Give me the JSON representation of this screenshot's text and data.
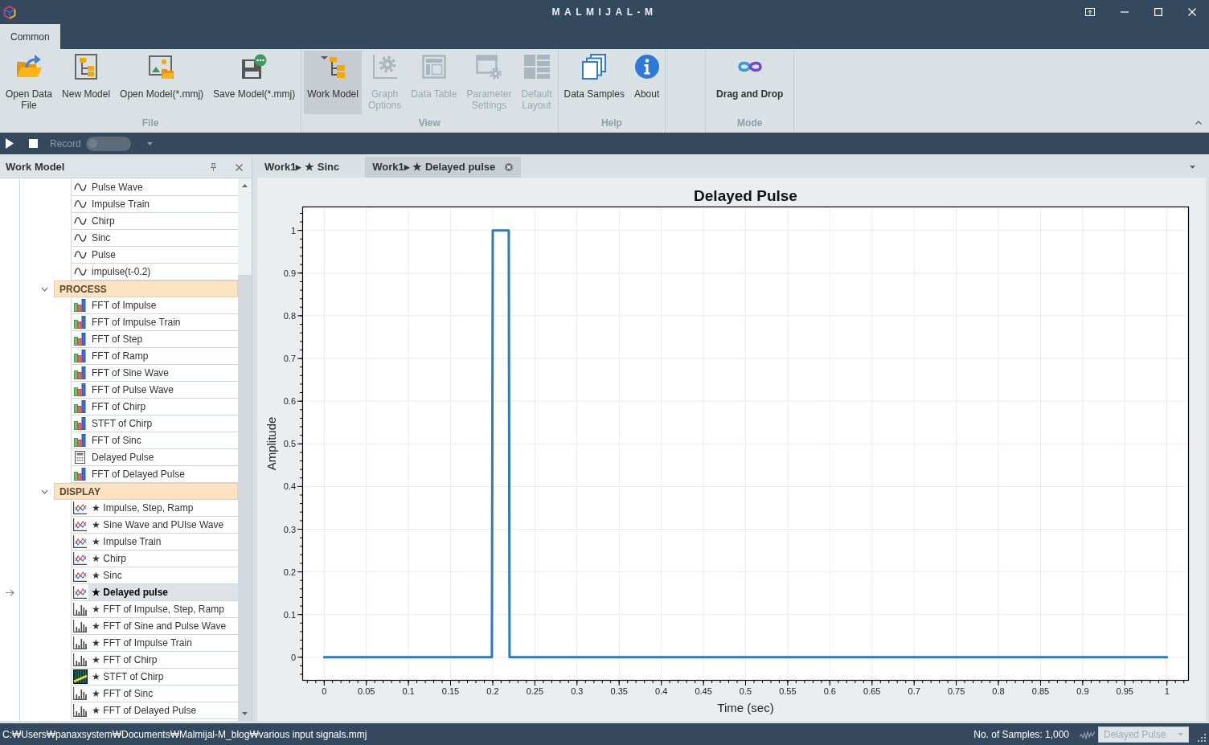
{
  "window": {
    "title": "MALMIJAL-M"
  },
  "ribbon": {
    "tabs": [
      {
        "label": "Common",
        "selected": true
      }
    ],
    "groups": [
      {
        "label": "File",
        "buttons": [
          {
            "kind": "open-data",
            "label": "Open Data\nFile",
            "selected": false,
            "disabled": false
          },
          {
            "kind": "new-model",
            "label": "New Model",
            "selected": false,
            "disabled": false
          },
          {
            "kind": "open-model",
            "label": "Open Model(*.mmj)",
            "selected": false,
            "disabled": false
          },
          {
            "kind": "save-model",
            "label": "Save Model(*.mmj)",
            "selected": false,
            "disabled": false
          }
        ]
      },
      {
        "label": "View",
        "buttons": [
          {
            "kind": "work-model",
            "label": "Work Model",
            "selected": true,
            "disabled": false
          },
          {
            "kind": "graph-options",
            "label": "Graph\nOptions",
            "selected": false,
            "disabled": true
          },
          {
            "kind": "data-table",
            "label": "Data Table",
            "selected": false,
            "disabled": true
          },
          {
            "kind": "parameter-settings",
            "label": "Parameter\nSettings",
            "selected": false,
            "disabled": true
          },
          {
            "kind": "default-layout",
            "label": "Default\nLayout",
            "selected": false,
            "disabled": true
          }
        ]
      },
      {
        "label": "Help",
        "buttons": [
          {
            "kind": "data-samples",
            "label": "Data Samples",
            "selected": false,
            "disabled": false
          },
          {
            "kind": "about",
            "label": "About",
            "selected": false,
            "disabled": false
          }
        ]
      },
      {
        "label": "Mode",
        "buttons": [
          {
            "kind": "drag-drop",
            "label": "Drag and Drop",
            "selected": false,
            "disabled": false,
            "on": true
          }
        ]
      }
    ]
  },
  "toolbar": {
    "record_label": "Record",
    "recording": false
  },
  "work_model_panel": {
    "title": "Work Model",
    "tree": [
      {
        "children": [
          {
            "kind": "signal",
            "label": "Pulse Wave",
            "selected": false
          },
          {
            "kind": "signal",
            "label": "Impulse Train",
            "selected": false
          },
          {
            "kind": "signal",
            "label": "Chirp",
            "selected": false
          },
          {
            "kind": "signal",
            "label": "Sinc",
            "selected": false
          },
          {
            "kind": "signal",
            "label": "Pulse",
            "selected": false
          },
          {
            "kind": "signal",
            "label": "impulse(t-0.2)",
            "selected": false
          }
        ]
      },
      {
        "label": "PROCESS",
        "expanded": true,
        "children": [
          {
            "kind": "fft",
            "label": "FFT of Impulse",
            "selected": false
          },
          {
            "kind": "fft",
            "label": "FFT of Impulse Train",
            "selected": false
          },
          {
            "kind": "fft",
            "label": "FFT of Step",
            "selected": false
          },
          {
            "kind": "fft",
            "label": "FFT of Ramp",
            "selected": false
          },
          {
            "kind": "fft",
            "label": "FFT of Sine Wave",
            "selected": false
          },
          {
            "kind": "fft",
            "label": "FFT of Pulse Wave",
            "selected": false
          },
          {
            "kind": "fft",
            "label": "FFT of Chirp",
            "selected": false
          },
          {
            "kind": "fft",
            "label": "STFT of Chirp",
            "selected": false
          },
          {
            "kind": "fft",
            "label": "FFT of Sinc",
            "selected": false
          },
          {
            "kind": "calculator",
            "label": "Delayed Pulse",
            "selected": false
          },
          {
            "kind": "fft",
            "label": "FFT of Delayed Pulse",
            "selected": false
          }
        ]
      },
      {
        "label": "DISPLAY",
        "expanded": true,
        "children": [
          {
            "kind": "line_chart",
            "label": "★ Impulse, Step, Ramp",
            "selected": false
          },
          {
            "kind": "line_chart",
            "label": "★ Sine Wave and PUlse Wave",
            "selected": false
          },
          {
            "kind": "line_chart",
            "label": "★ Impulse Train",
            "selected": false
          },
          {
            "kind": "line_chart",
            "label": "★ Chirp",
            "selected": false
          },
          {
            "kind": "line_chart",
            "label": "★ Sinc",
            "selected": false
          },
          {
            "kind": "line_chart",
            "label": "★ Delayed pulse",
            "selected": true
          },
          {
            "kind": "bar_chart",
            "label": "★ FFT of Impulse, Step, Ramp",
            "selected": false
          },
          {
            "kind": "bar_chart",
            "label": "★ FFT of Sine and Pulse Wave",
            "selected": false
          },
          {
            "kind": "bar_chart",
            "label": "★ FFT of Impulse Train",
            "selected": false
          },
          {
            "kind": "bar_chart",
            "label": "★ FFT of Chirp",
            "selected": false
          },
          {
            "kind": "spectrogram",
            "label": "★ STFT of Chirp",
            "selected": false
          },
          {
            "kind": "bar_chart",
            "label": "★ FFT of Sinc",
            "selected": false
          },
          {
            "kind": "bar_chart",
            "label": "★ FFT of Delayed Pulse",
            "selected": false
          }
        ]
      }
    ]
  },
  "document_tabs": [
    {
      "label": "Work1▸ ★ Sinc",
      "selected": false
    },
    {
      "label": "Work1▸ ★ Delayed pulse",
      "selected": true
    }
  ],
  "chart_panel": {
    "chart_data": {
      "type": "line",
      "title": "Delayed Pulse",
      "xlabel": "Time (sec)",
      "ylabel": "Amplitude",
      "grid": true,
      "x": [
        0,
        0.199,
        0.2,
        0.219,
        0.22,
        1
      ],
      "series": [
        {
          "color": "#2b7bbd",
          "values": [
            0,
            0,
            1,
            1,
            0,
            0
          ]
        }
      ],
      "xlim": [
        -0.026,
        1.026
      ],
      "ylim": [
        -0.055,
        1.056
      ],
      "xticks": [
        0,
        0.05,
        0.1,
        0.15,
        0.2,
        0.25,
        0.3,
        0.35,
        0.4,
        0.45,
        0.5,
        0.55,
        0.6,
        0.65,
        0.7,
        0.75,
        0.8,
        0.85,
        0.9,
        0.95,
        1
      ],
      "yticks": [
        0,
        0.1,
        0.2,
        0.3,
        0.4,
        0.5,
        0.6,
        0.7,
        0.8,
        0.9,
        1
      ]
    }
  },
  "status_bar": {
    "path": "C:₩Users₩panaxsystem₩Documents₩Malmijal-M_blog₩various input signals.mmj",
    "samples": "No. of Samples: 1,000",
    "signal_select": {
      "value": "Delayed Pulse",
      "disabled": true
    }
  }
}
